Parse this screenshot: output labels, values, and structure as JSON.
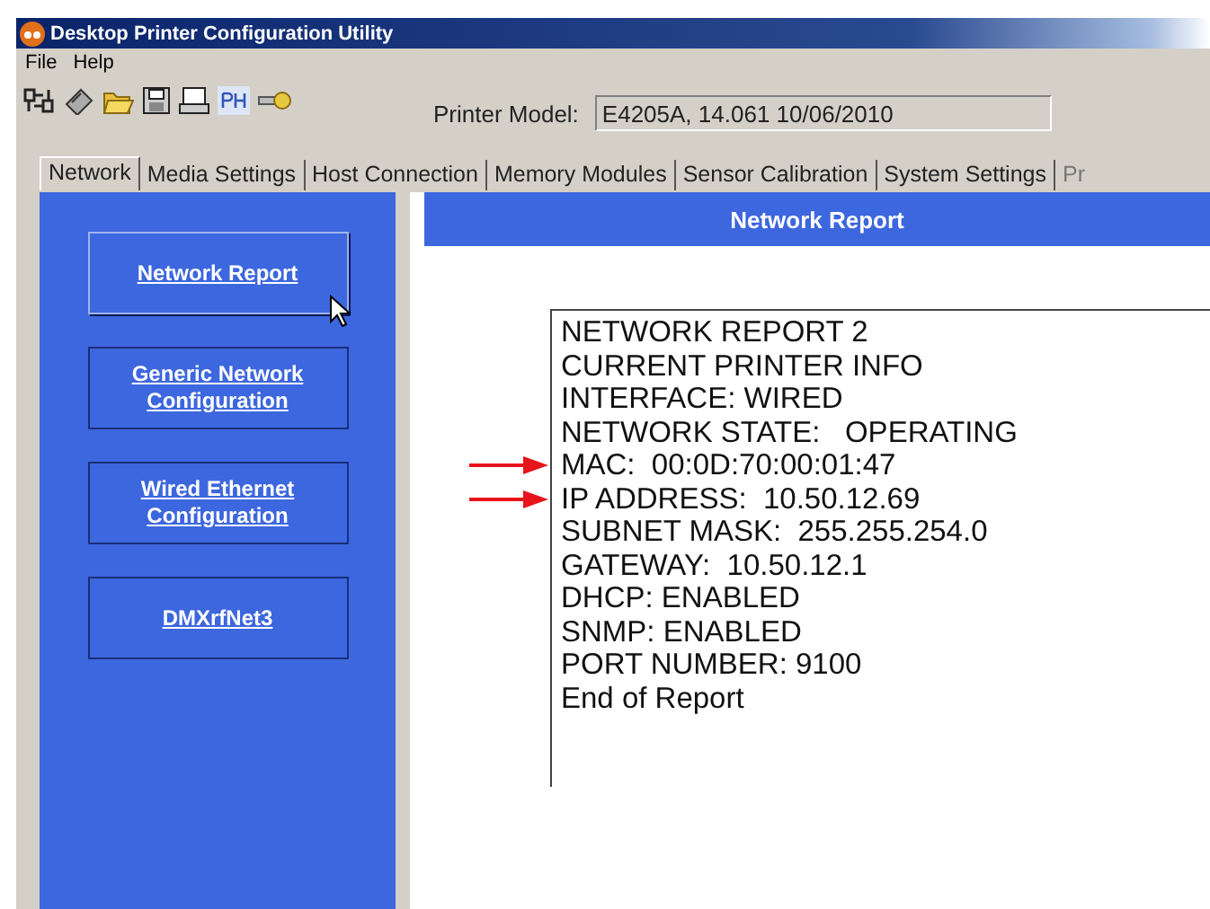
{
  "window": {
    "title": "Desktop Printer Configuration Utility"
  },
  "menu": [
    "File",
    "Help"
  ],
  "printer_model": {
    "label": "Printer Model:",
    "value": "E4205A, 14.061 10/06/2010"
  },
  "tabs": [
    {
      "label": "Network",
      "selected": true
    },
    {
      "label": "Media Settings",
      "selected": false
    },
    {
      "label": "Host Connection",
      "selected": false
    },
    {
      "label": "Memory Modules",
      "selected": false
    },
    {
      "label": "Sensor Calibration",
      "selected": false
    },
    {
      "label": "System Settings",
      "selected": false
    },
    {
      "label": "Pr",
      "selected": false
    }
  ],
  "sidebar": {
    "items": [
      {
        "label": "Network Report",
        "selected": true
      },
      {
        "label": "Generic Network Configuration",
        "selected": false
      },
      {
        "label": "Wired Ethernet Configuration",
        "selected": false
      },
      {
        "label": "DMXrfNet3",
        "selected": false
      }
    ]
  },
  "report": {
    "title": "Network Report",
    "lines": [
      {
        "text": "NETWORK REPORT 2",
        "marked": false
      },
      {
        "text": "CURRENT PRINTER INFO",
        "marked": false
      },
      {
        "text": "INTERFACE: WIRED",
        "marked": false
      },
      {
        "text": "NETWORK STATE:   OPERATING",
        "marked": false
      },
      {
        "text": "MAC:  00:0D:70:00:01:47",
        "marked": true
      },
      {
        "text": "IP ADDRESS:  10.50.12.69",
        "marked": true
      },
      {
        "text": "SUBNET MASK:  255.255.254.0",
        "marked": false
      },
      {
        "text": "GATEWAY:  10.50.12.1",
        "marked": false
      },
      {
        "text": "DHCP: ENABLED",
        "marked": false
      },
      {
        "text": "SNMP: ENABLED",
        "marked": false
      },
      {
        "text": "PORT NUMBER: 9100",
        "marked": false
      },
      {
        "text": "End of Report",
        "marked": false
      }
    ]
  }
}
